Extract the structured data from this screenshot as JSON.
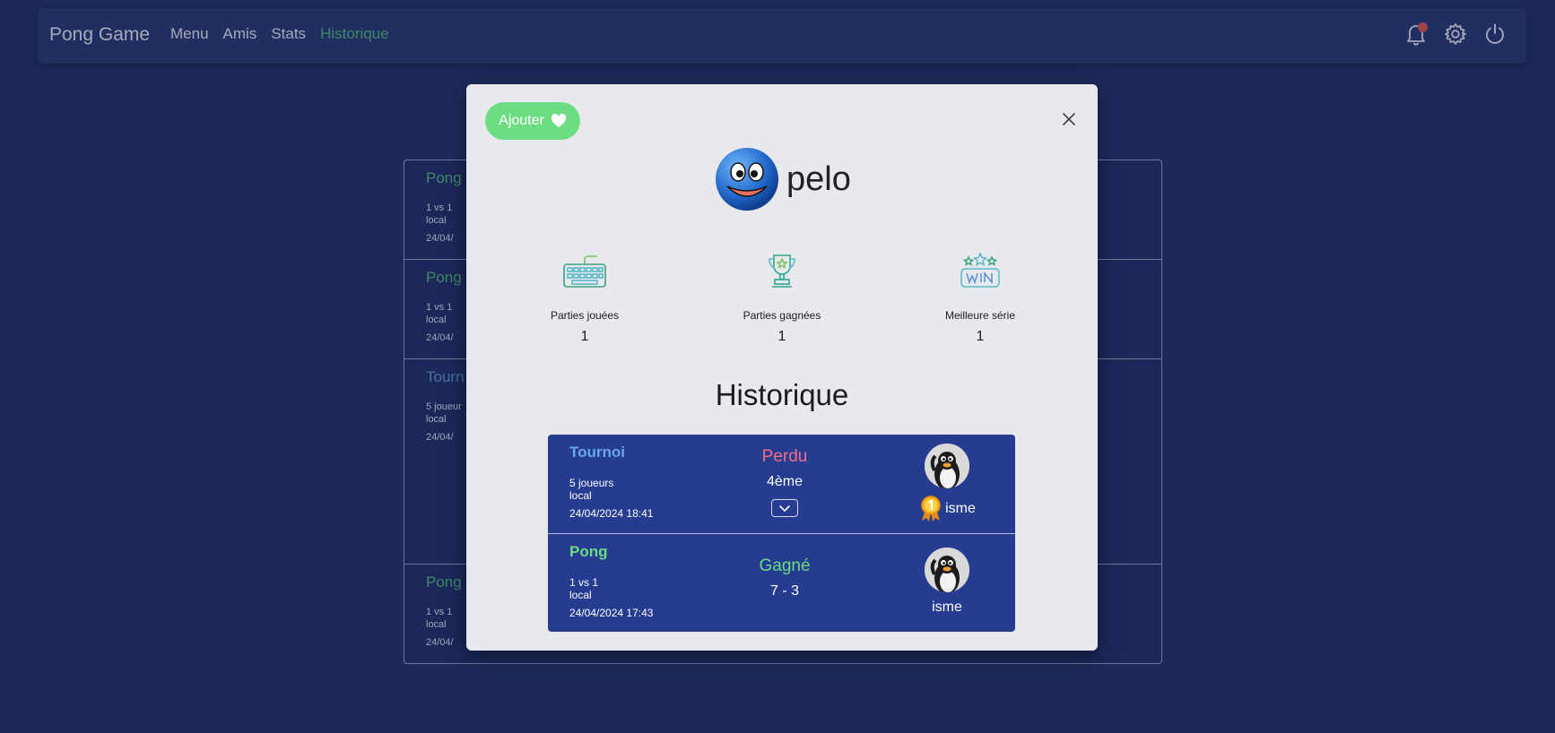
{
  "nav": {
    "brand": "Pong Game",
    "links": [
      "Menu",
      "Amis",
      "Stats",
      "Historique"
    ],
    "active_link": "Historique",
    "icons": [
      "bell-icon",
      "gear-icon",
      "power-icon"
    ],
    "notification_color": "#c8504b"
  },
  "background_history": [
    {
      "title": "Pong",
      "mode": "1 vs 1",
      "location": "local",
      "date": "24/04/"
    },
    {
      "title": "Pong",
      "mode": "1 vs 1",
      "location": "local",
      "date": "24/04/"
    },
    {
      "title": "Tourn",
      "mode": "5 joueur",
      "location": "local",
      "date": "24/04/"
    },
    {
      "title": "Pong",
      "mode": "1 vs 1",
      "location": "local",
      "date": "24/04/"
    }
  ],
  "modal": {
    "add_label": "Ajouter",
    "username": "pelo",
    "stats": [
      {
        "label": "Parties jouées",
        "value": "1",
        "icon": "keyboard-icon"
      },
      {
        "label": "Parties gagnées",
        "value": "1",
        "icon": "trophy-icon"
      },
      {
        "label": "Meilleure série",
        "value": "1",
        "icon": "win-stars-icon"
      }
    ],
    "history_title": "Historique",
    "matches": [
      {
        "type": "Tournoi",
        "mode": "5 joueurs",
        "location": "local",
        "date": "24/04/2024 18:41",
        "result": "Perdu",
        "detail": "4ème",
        "opponent": "isme",
        "winner_badge": true
      },
      {
        "type": "Pong",
        "mode": "1 vs 1",
        "location": "local",
        "date": "24/04/2024 17:43",
        "result": "Gagné",
        "detail": "7 - 3",
        "opponent": "isme",
        "winner_badge": false
      }
    ]
  },
  "colors": {
    "background": "#202f66",
    "navbar": "#24356f",
    "accent_green": "#4fae73",
    "add_button": "#6ddd84",
    "match_card": "#253c90",
    "lose": "#f26e8a",
    "win": "#6ddd84",
    "tournament": "#6aa7e6"
  }
}
